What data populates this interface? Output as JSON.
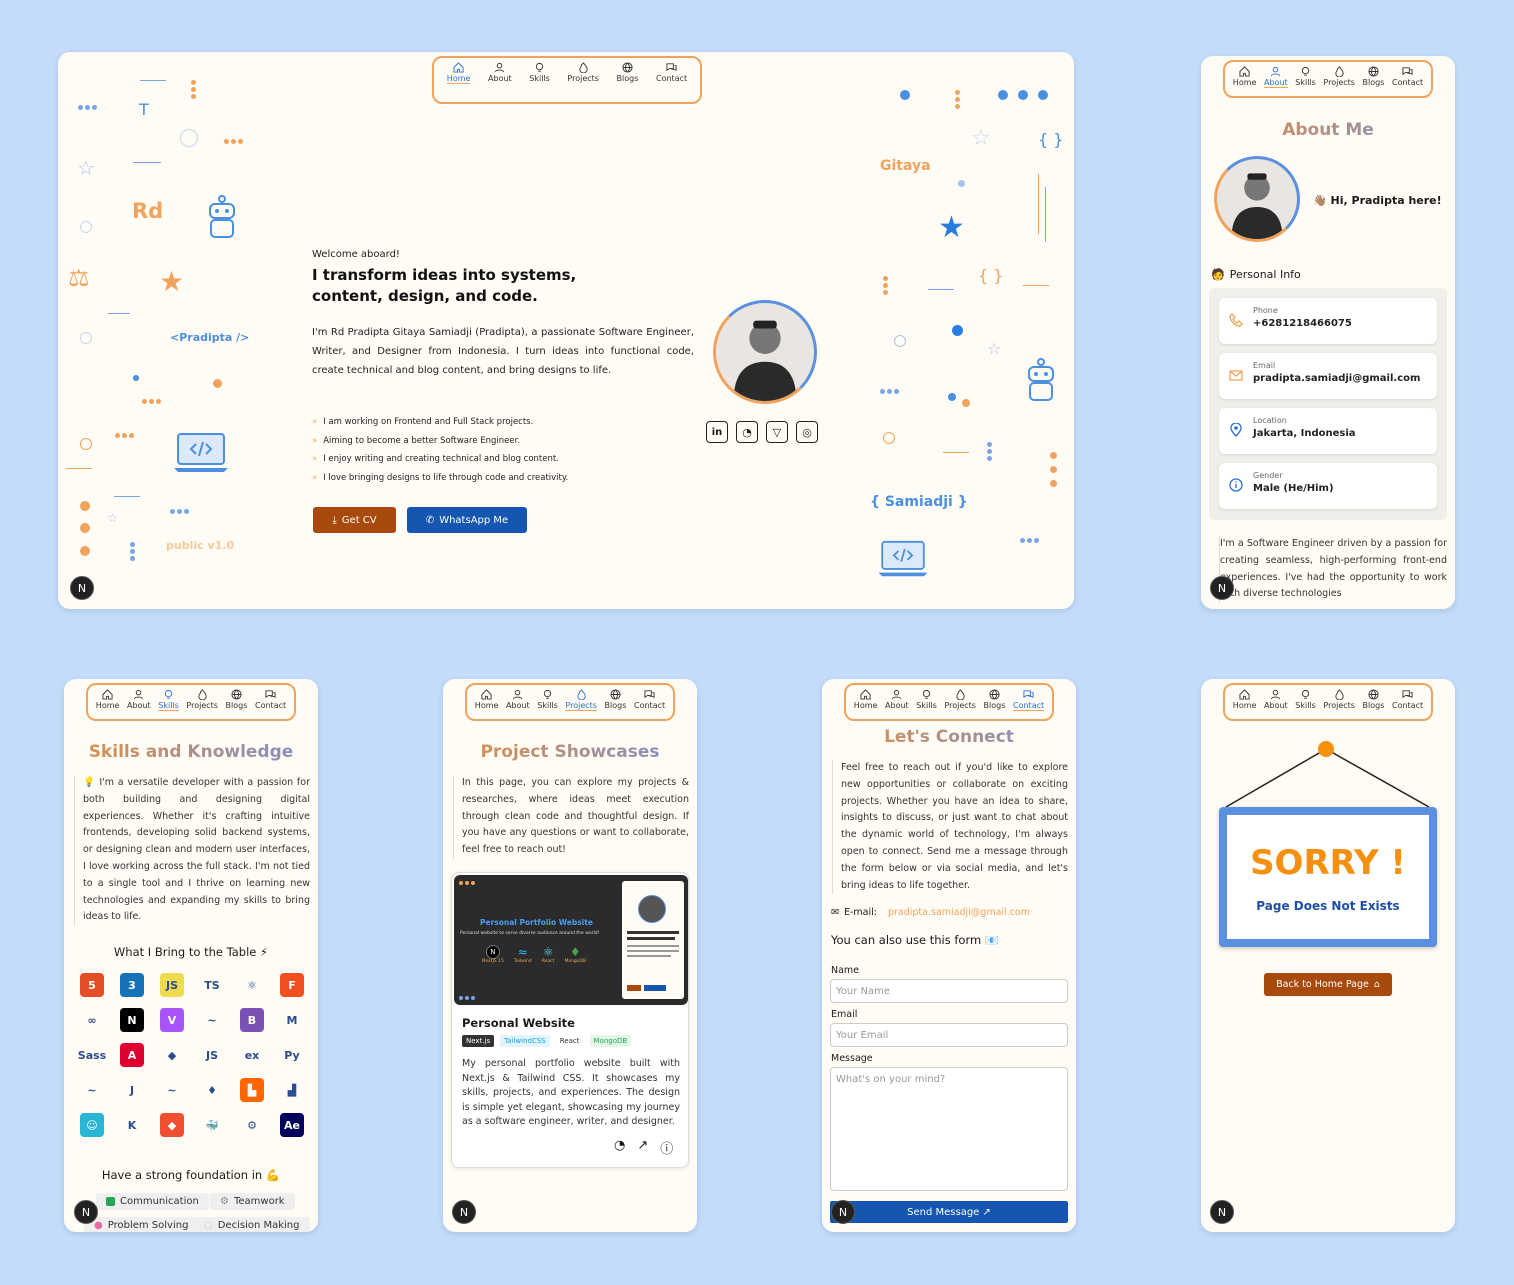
{
  "nav": {
    "items": [
      "Home",
      "About",
      "Skills",
      "Projects",
      "Blogs",
      "Contact"
    ]
  },
  "badge": "N",
  "home": {
    "welcome": "Welcome aboard!",
    "headline": "I transform ideas into systems, content, design, and code.",
    "intro": "I'm Rd Pradipta Gitaya Samiadji (Pradipta), a passionate Software Engineer, Writer, and Designer from Indonesia. I turn ideas into functional code, create technical and blog content, and bring designs to life.",
    "bullets": [
      "I am working on Frontend and Full Stack projects.",
      "Aiming to become a better Software Engineer.",
      "I enjoy writing and creating technical and blog content.",
      "I love bringing designs to life through code and creativity."
    ],
    "cv_button": "Get CV",
    "whatsapp_button": "WhatsApp Me",
    "decor": {
      "rd": "Rd",
      "pradipta": "<Pradipta />",
      "public": "public v1.0",
      "gitaya": "Gitaya",
      "samiadji": "{ Samiadji }",
      "t": "T",
      "braces": "{ }",
      "braces2": "{ }"
    },
    "colors": {
      "accent": "#e3913f",
      "blue": "#2a6fd6",
      "cv": "#a8490d",
      "wa": "#1557b0"
    }
  },
  "about": {
    "title": "About Me",
    "greeting": "👋🏽 Hi, Pradipta here!",
    "section": "Personal Info",
    "fields": [
      {
        "label": "Phone",
        "value": "+6281218466075",
        "icon": "phone-icon"
      },
      {
        "label": "Email",
        "value": "pradipta.samiadji@gmail.com",
        "icon": "mail-icon"
      },
      {
        "label": "Location",
        "value": "Jakarta, Indonesia",
        "icon": "location-icon"
      },
      {
        "label": "Gender",
        "value": "Male (He/Him)",
        "icon": "info-icon"
      }
    ],
    "bio": "I'm a Software Engineer driven by a passion for creating seamless, high-performing front-end experiences. I've had the opportunity to work with diverse technologies"
  },
  "skills": {
    "title": "Skills and Knowledge",
    "intro": "💡 I'm a versatile developer with a passion for both building and designing digital experiences. Whether it's crafting intuitive frontends, developing solid backend systems, or designing clean and modern user interfaces, I love working across the full stack. I'm not tied to a single tool and I thrive on learning new technologies and expanding my skills to bring ideas to life.",
    "bring_title": "What I Bring to the Table ⚡",
    "icons": [
      {
        "t": "5",
        "c": "#e44d26"
      },
      {
        "t": "3",
        "c": "#1572b6"
      },
      {
        "t": "JS",
        "c": "#f0db4f"
      },
      {
        "t": "TS",
        "c": "#ffffff"
      },
      {
        "t": "⚛",
        "c": "#ffffff"
      },
      {
        "t": "F",
        "c": "#f24e1e"
      },
      {
        "t": "∞",
        "c": "#ffffff"
      },
      {
        "t": "N",
        "c": "#000000"
      },
      {
        "t": "V",
        "c": "#a855f7"
      },
      {
        "t": "~",
        "c": "#ffffff"
      },
      {
        "t": "B",
        "c": "#7952b3"
      },
      {
        "t": "M",
        "c": "#ffffff"
      },
      {
        "t": "Sass",
        "c": "#ffffff"
      },
      {
        "t": "A",
        "c": "#dd0031"
      },
      {
        "t": "◆",
        "c": "#ffffff"
      },
      {
        "t": "JS",
        "c": "#ffffff"
      },
      {
        "t": "ex",
        "c": "#ffffff"
      },
      {
        "t": "Py",
        "c": "#ffffff"
      },
      {
        "t": "~",
        "c": "#ffffff"
      },
      {
        "t": "J",
        "c": "#ffffff"
      },
      {
        "t": "~",
        "c": "#ffffff"
      },
      {
        "t": "♦",
        "c": "#ffffff"
      },
      {
        "t": "▙",
        "c": "#ff6600"
      },
      {
        "t": "▟",
        "c": "#ffffff"
      },
      {
        "t": "☺",
        "c": "#29b6d6"
      },
      {
        "t": "K",
        "c": "#ffffff"
      },
      {
        "t": "◆",
        "c": "#f05032"
      },
      {
        "t": "🐳",
        "c": "#ffffff"
      },
      {
        "t": "⚙",
        "c": "#ffffff"
      },
      {
        "t": "Ae",
        "c": "#00005b"
      }
    ],
    "foundation_title": "Have a strong foundation in 💪",
    "chips": [
      "Communication",
      "Teamwork",
      "Problem Solving",
      "Decision Making"
    ]
  },
  "projects": {
    "title": "Project Showcases",
    "intro": "In this page, you can explore my projects & researches, where ideas meet execution through clean code and thoughtful design. If you have any questions or want to collaborate, feel free to reach out!",
    "preview_title": "Personal Portfolio Website",
    "preview_sub": "Personal website to serve diverse audience around the world!",
    "preview_tech": [
      "NextJS 15",
      "Tailwind",
      "React",
      "MongoDB"
    ],
    "card_title": "Personal Website",
    "tags": [
      "Next.js",
      "TailwindCSS",
      "React",
      "MongoDB"
    ],
    "card_desc": "My personal portfolio website built with Next.js & Tailwind CSS. It showcases my skills, projects, and experiences. The design is simple yet elegant, showcasing my journey as a software engineer, writer, and designer."
  },
  "contact": {
    "title": "Let's Connect",
    "intro": "Feel free to reach out if you'd like to explore new opportunities or collaborate on exciting projects. Whether you have an idea to share, insights to discuss, or just want to chat about the dynamic world of technology, I'm always open to connect. Send me a message through the form below or via social media, and let's bring ideas to life together.",
    "email_label": "E-mail:",
    "email": "pradipta.samiadji@gmail.com",
    "form_title": "You can also use this form 📧",
    "name_label": "Name",
    "name_placeholder": "Your Name",
    "email_field_label": "Email",
    "email_placeholder": "Your Email",
    "message_label": "Message",
    "message_placeholder": "What's on your mind?",
    "send": "Send Message ↗"
  },
  "notfound": {
    "sorry": "SORRY !",
    "message": "Page Does Not Exists",
    "back": "Back to Home Page"
  }
}
